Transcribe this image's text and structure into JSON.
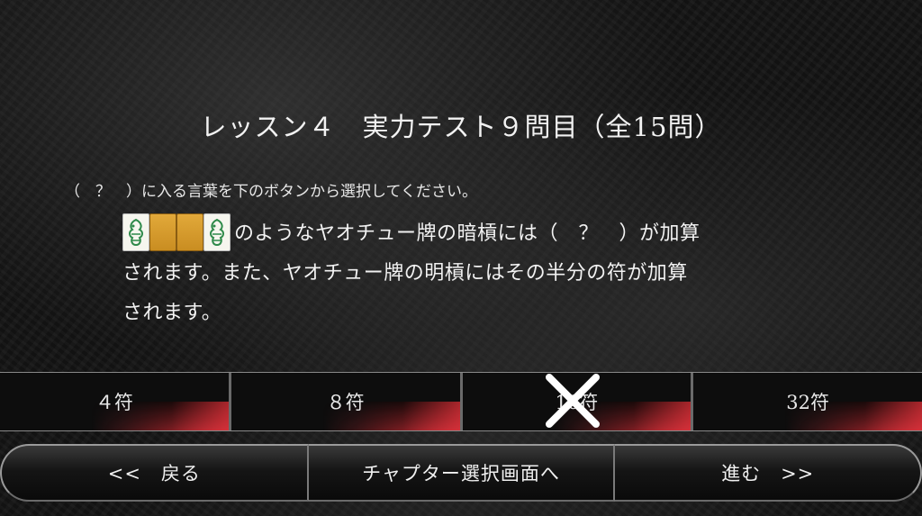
{
  "title": "レッスン４　実力テスト９問目（全15問）",
  "instruction": "（　？　）に入る言葉を下のボタンから選択してください。",
  "question": {
    "tiles": [
      "dragon-tile",
      "tile-back",
      "tile-back",
      "dragon-tile"
    ],
    "line1": "のようなヤオチュー牌の暗槓には（　？　）が加算",
    "line2": "されます。また、ヤオチュー牌の明槓にはその半分の符が加算",
    "line3": "されます。"
  },
  "answers": [
    "４符",
    "８符",
    "16符",
    "32符"
  ],
  "wrong_answer_index": 2,
  "nav": {
    "back": "<<　戻る",
    "chapter": "チャプター選択画面へ",
    "next": "進む　>>"
  },
  "colors": {
    "accent_red": "#d93340",
    "tile_back": "#d9a032",
    "dragon_green": "#2f8a4a"
  }
}
